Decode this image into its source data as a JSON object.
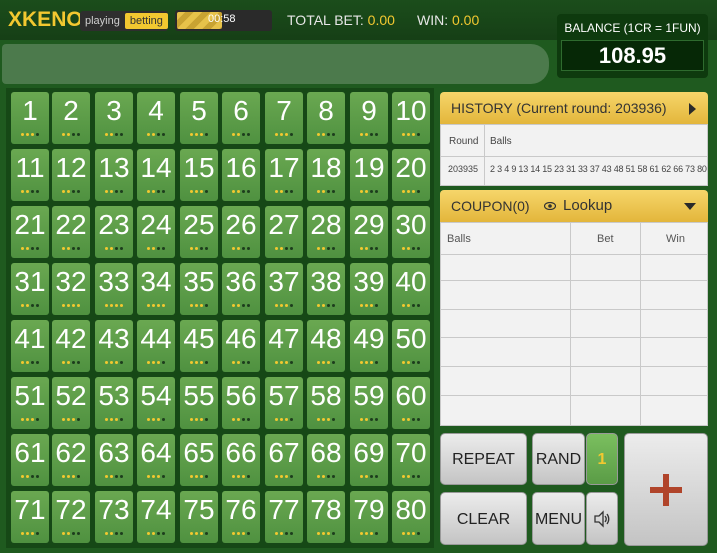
{
  "header": {
    "logo_x": "X",
    "logo_text": "KENO",
    "mode_playing": "playing",
    "mode_betting": "betting",
    "timer": "00:58",
    "timer_fill_fraction": 0.48,
    "total_bet_label": "TOTAL BET:",
    "total_bet_value": "0.00",
    "win_label": "WIN:",
    "win_value": "0.00"
  },
  "balance": {
    "label": "BALANCE (1CR = 1FUN)",
    "value": "108.95"
  },
  "board": {
    "numbers": [
      "1",
      "2",
      "3",
      "4",
      "5",
      "6",
      "7",
      "8",
      "9",
      "10",
      "11",
      "12",
      "13",
      "14",
      "15",
      "16",
      "17",
      "18",
      "19",
      "20",
      "21",
      "22",
      "23",
      "24",
      "25",
      "26",
      "27",
      "28",
      "29",
      "30",
      "31",
      "32",
      "33",
      "34",
      "35",
      "36",
      "37",
      "38",
      "39",
      "40",
      "41",
      "42",
      "43",
      "44",
      "45",
      "46",
      "47",
      "48",
      "49",
      "50",
      "51",
      "52",
      "53",
      "54",
      "55",
      "56",
      "57",
      "58",
      "59",
      "60",
      "61",
      "62",
      "63",
      "64",
      "65",
      "66",
      "67",
      "68",
      "69",
      "70",
      "71",
      "72",
      "73",
      "74",
      "75",
      "76",
      "77",
      "78",
      "79",
      "80"
    ],
    "dots": [
      [
        1,
        1,
        1,
        0
      ],
      [
        1,
        1,
        0,
        0
      ],
      [
        1,
        1,
        0,
        0
      ],
      [
        1,
        1,
        0,
        0
      ],
      [
        1,
        1,
        1,
        0
      ],
      [
        1,
        1,
        0,
        0
      ],
      [
        1,
        1,
        1,
        0
      ],
      [
        1,
        1,
        0,
        0
      ],
      [
        1,
        1,
        0,
        0
      ],
      [
        1,
        1,
        1,
        0
      ],
      [
        1,
        1,
        0,
        0
      ],
      [
        1,
        1,
        0,
        0
      ],
      [
        1,
        1,
        0,
        0
      ],
      [
        1,
        1,
        0,
        0
      ],
      [
        1,
        1,
        1,
        0
      ],
      [
        1,
        1,
        0,
        0
      ],
      [
        1,
        1,
        0,
        0
      ],
      [
        1,
        1,
        0,
        0
      ],
      [
        1,
        1,
        0,
        0
      ],
      [
        1,
        1,
        1,
        0
      ],
      [
        1,
        1,
        0,
        0
      ],
      [
        1,
        1,
        0,
        0
      ],
      [
        1,
        1,
        0,
        0
      ],
      [
        1,
        1,
        0,
        0
      ],
      [
        1,
        1,
        0,
        0
      ],
      [
        1,
        1,
        0,
        0
      ],
      [
        1,
        1,
        0,
        0
      ],
      [
        1,
        1,
        0,
        0
      ],
      [
        1,
        1,
        0,
        0
      ],
      [
        1,
        1,
        0,
        0
      ],
      [
        1,
        1,
        0,
        0
      ],
      [
        1,
        1,
        1,
        1
      ],
      [
        1,
        1,
        1,
        1
      ],
      [
        1,
        1,
        1,
        1
      ],
      [
        1,
        1,
        1,
        0
      ],
      [
        1,
        1,
        0,
        0
      ],
      [
        1,
        1,
        1,
        0
      ],
      [
        1,
        1,
        0,
        0
      ],
      [
        1,
        1,
        1,
        0
      ],
      [
        1,
        1,
        0,
        0
      ],
      [
        1,
        1,
        0,
        0
      ],
      [
        1,
        1,
        0,
        0
      ],
      [
        1,
        1,
        1,
        0
      ],
      [
        1,
        1,
        1,
        0
      ],
      [
        1,
        1,
        1,
        0
      ],
      [
        1,
        1,
        0,
        0
      ],
      [
        1,
        1,
        1,
        0
      ],
      [
        1,
        1,
        1,
        0
      ],
      [
        1,
        1,
        1,
        0
      ],
      [
        1,
        1,
        0,
        0
      ],
      [
        1,
        1,
        1,
        0
      ],
      [
        1,
        1,
        1,
        0
      ],
      [
        1,
        1,
        1,
        0
      ],
      [
        1,
        1,
        1,
        0
      ],
      [
        1,
        1,
        1,
        0
      ],
      [
        1,
        1,
        0,
        0
      ],
      [
        1,
        1,
        1,
        0
      ],
      [
        1,
        1,
        1,
        0
      ],
      [
        1,
        1,
        0,
        0
      ],
      [
        1,
        1,
        0,
        0
      ],
      [
        1,
        1,
        0,
        0
      ],
      [
        1,
        1,
        1,
        0
      ],
      [
        1,
        1,
        0,
        0
      ],
      [
        1,
        1,
        1,
        0
      ],
      [
        1,
        1,
        1,
        0
      ],
      [
        1,
        1,
        1,
        0
      ],
      [
        1,
        1,
        1,
        0
      ],
      [
        1,
        1,
        0,
        0
      ],
      [
        1,
        1,
        0,
        0
      ],
      [
        1,
        1,
        0,
        0
      ],
      [
        1,
        1,
        1,
        0
      ],
      [
        1,
        1,
        0,
        0
      ],
      [
        1,
        1,
        0,
        0
      ],
      [
        1,
        1,
        0,
        0
      ],
      [
        1,
        1,
        1,
        0
      ],
      [
        1,
        1,
        1,
        0
      ],
      [
        1,
        1,
        0,
        0
      ],
      [
        1,
        1,
        1,
        0
      ],
      [
        1,
        1,
        1,
        0
      ],
      [
        1,
        1,
        1,
        0
      ]
    ]
  },
  "history": {
    "title": "HISTORY (Current round: 203936)",
    "col_round": "Round",
    "col_balls": "Balls",
    "rows": [
      {
        "round": "203935",
        "balls": "2 3 4 9 13 14 15 23 31 33 37 43 48 51 58 61 62 66 73 80"
      }
    ]
  },
  "coupon": {
    "title": "COUPON(0)",
    "lookup": "Lookup",
    "col_balls": "Balls",
    "col_bet": "Bet",
    "col_win": "Win"
  },
  "buttons": {
    "repeat": "REPEAT",
    "rand": "RAND",
    "rand_count": "1",
    "clear": "CLEAR",
    "menu": "MENU"
  },
  "icons": {
    "sound": "speaker-icon",
    "plus": "plus-icon",
    "eye": "eye-icon"
  }
}
